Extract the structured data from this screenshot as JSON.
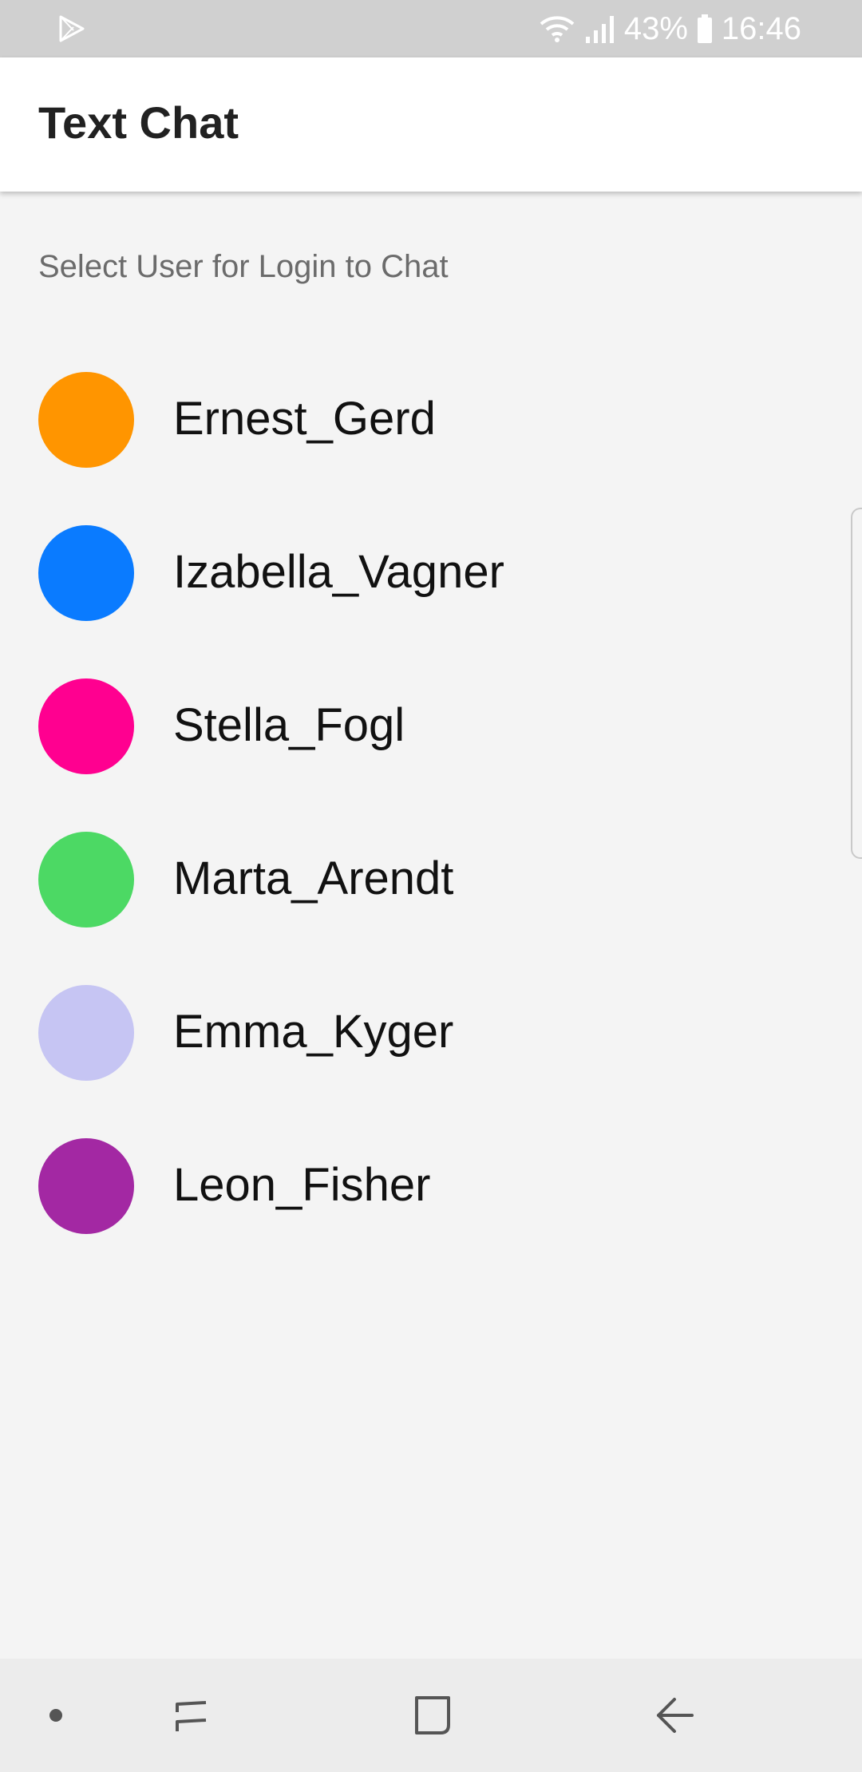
{
  "status_bar": {
    "battery_percent": "43%",
    "time": "16:46",
    "icons": [
      "play-store-icon",
      "wifi-icon",
      "signal-icon",
      "battery-icon"
    ]
  },
  "app_bar": {
    "title": "Text Chat"
  },
  "content": {
    "subtitle": "Select User for Login to Chat",
    "users": [
      {
        "name": "Ernest_Gerd",
        "color": "#ff9500"
      },
      {
        "name": "Izabella_Vagner",
        "color": "#0a7bff"
      },
      {
        "name": "Stella_Fogl",
        "color": "#ff0090"
      },
      {
        "name": "Marta_Arendt",
        "color": "#4cd964"
      },
      {
        "name": "Emma_Kyger",
        "color": "#c6c5f3"
      },
      {
        "name": "Leon_Fisher",
        "color": "#a328a3"
      }
    ]
  },
  "nav_bar": {
    "icons": [
      "dot-icon",
      "recent-apps-icon",
      "home-icon",
      "back-icon"
    ]
  }
}
